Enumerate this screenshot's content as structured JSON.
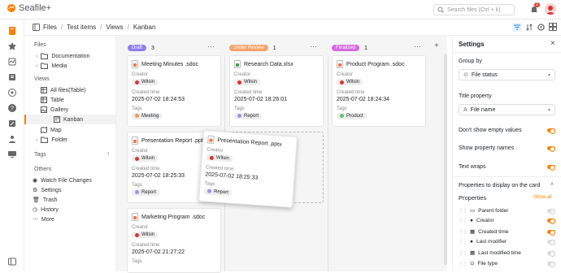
{
  "app": {
    "name": "Seafile+"
  },
  "search": {
    "placeholder": "Search files (Ctrl + k)"
  },
  "notifications": {
    "count": "2"
  },
  "breadcrumb": [
    "Files",
    "Test items",
    "Views",
    "Kanban"
  ],
  "nav": {
    "files_label": "Files",
    "files": [
      "Documentation",
      "Media"
    ],
    "views_label": "Views",
    "views": [
      "All files(Table)",
      "Table",
      "Gallery",
      "Kanban",
      "Map",
      "Folder"
    ],
    "tags_label": "Tags",
    "others_label": "Others",
    "others": [
      "Watch File Changes",
      "Settings",
      "Trash",
      "History",
      "More"
    ]
  },
  "board": {
    "columns": [
      {
        "name": "Draft",
        "count": "3",
        "color": "#8e7cf0"
      },
      {
        "name": "Under Review",
        "count": "1",
        "color": "#f5a36b"
      },
      {
        "name": "Finalized",
        "count": "1",
        "color": "#d66be0"
      }
    ],
    "labels": {
      "creator": "Creator",
      "created_time": "Created time",
      "tags": "Tags"
    },
    "cards": [
      {
        "title": "Meeting Minutes .sdoc",
        "creator": "Wilsin",
        "time": "2025-07-02 18:24:53",
        "tag": "Meeting",
        "tag_color": "#f19a5b",
        "icon": "sdoc-icon"
      },
      {
        "title": "Presentation Report .pptx",
        "creator": "Wilsin",
        "time": "2025-07-02 18:25:33",
        "tag": "Report",
        "tag_color": "#a48ee8",
        "icon": "pptx-icon"
      },
      {
        "title": "Marketing Program .sdoc",
        "creator": "Wilsin",
        "time": "2025-07-02 21:27:22",
        "tag": "",
        "icon": "sdoc-icon"
      },
      {
        "title": "Research Data.xlsx",
        "creator": "Wilsin",
        "time": "2025-07-02 18:26:01",
        "tag": "Report",
        "tag_color": "#a48ee8",
        "icon": "xlsx-icon"
      },
      {
        "title": "Product Program .sdoc",
        "creator": "Wilsin",
        "time": "2025-07-02 18:24:34",
        "tag": "Product",
        "tag_color": "#5cc46b",
        "icon": "sdoc-icon"
      },
      {
        "title": "Presentation Report .pptx",
        "creator": "Wilsin",
        "time": "2025-07-02 18:25:33",
        "tag": "Report",
        "tag_color": "#a48ee8",
        "icon": "pptx-icon"
      }
    ]
  },
  "settings": {
    "title": "Settings",
    "group_by_label": "Group by",
    "group_by_value": "File status",
    "title_property_label": "Title property",
    "title_property_value": "File name",
    "toggles": [
      {
        "label": "Don't show empty values",
        "on": true
      },
      {
        "label": "Show property names",
        "on": true
      },
      {
        "label": "Text wraps",
        "on": true
      }
    ],
    "display_label": "Properties to display on the card",
    "properties_label": "Properties",
    "show_all": "Show all",
    "properties": [
      {
        "name": "Parent folder",
        "on": false
      },
      {
        "name": "Creator",
        "on": true
      },
      {
        "name": "Created time",
        "on": true
      },
      {
        "name": "Last modifier",
        "on": false
      },
      {
        "name": "Last modified time",
        "on": false
      },
      {
        "name": "File type",
        "on": false
      }
    ]
  },
  "colors": {
    "accent": "#ff8000",
    "brand": "#ff8000"
  }
}
